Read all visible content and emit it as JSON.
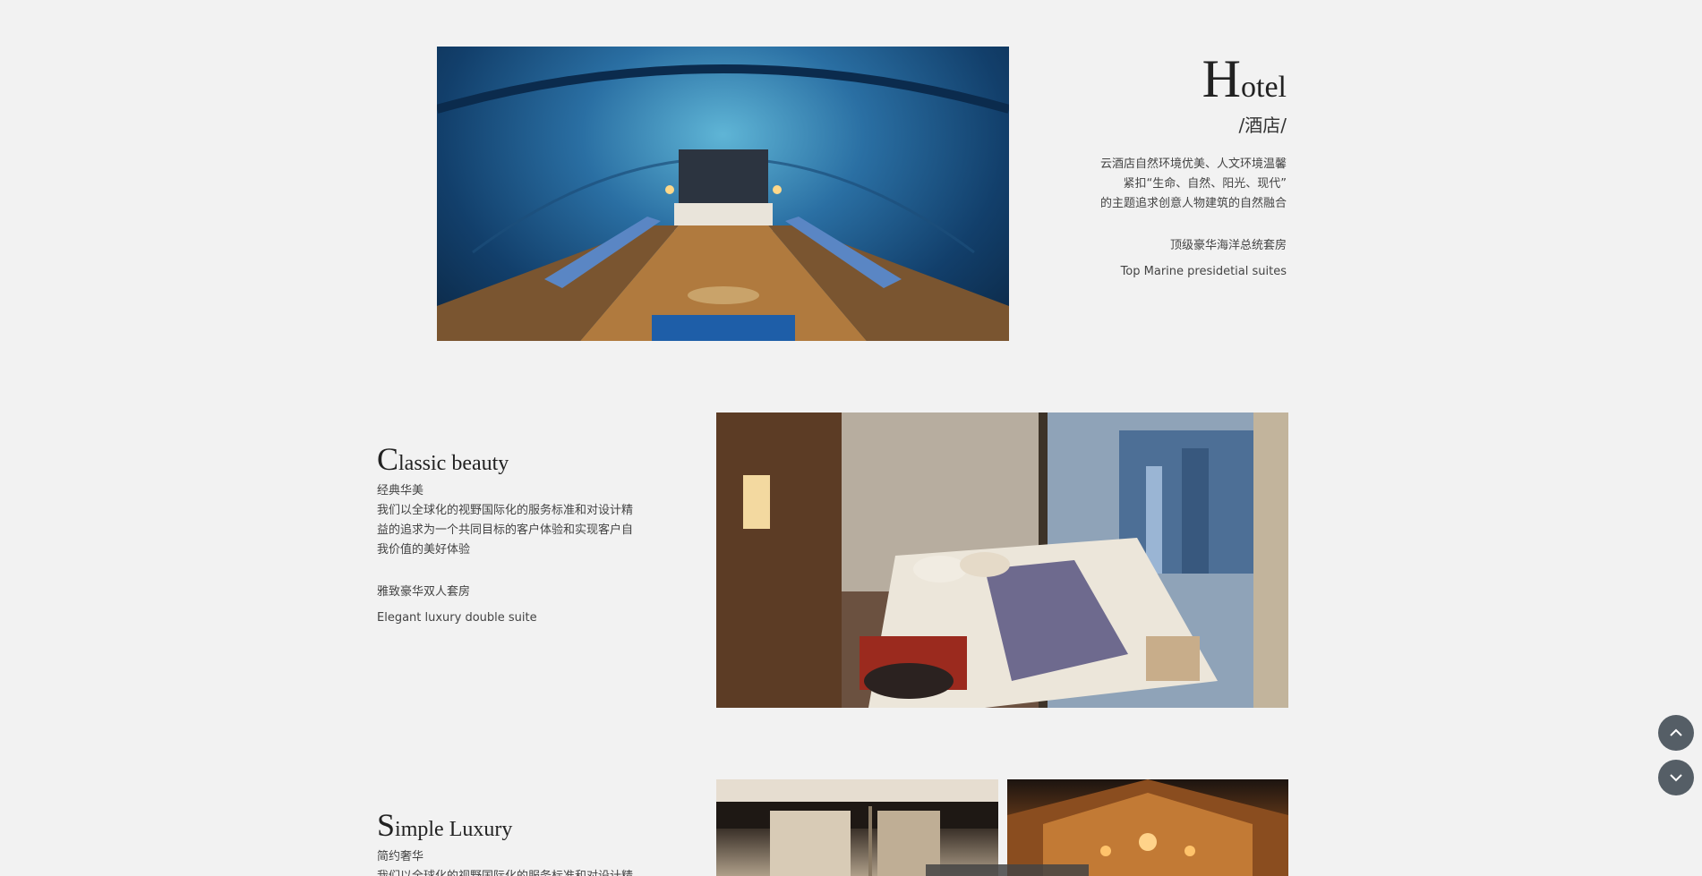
{
  "hotel": {
    "title_cap": "H",
    "title_rest": "otel",
    "subtitle": "/酒店/",
    "desc_lines": [
      "云酒店自然环境优美、人文环境温馨",
      "紧扣“生命、自然、阳光、现代”",
      "的主题追求创意人物建筑的自然融合"
    ],
    "suite_cn": "顶级豪华海洋总统套房",
    "suite_en": "Top Marine presidetial suites"
  },
  "classic": {
    "title_cap": "C",
    "title_rest": "lassic beauty",
    "subtitle_cn": "经典华美",
    "desc_lines": [
      "我们以全球化的视野国际化的服务标准和对设计精",
      "益的追求为一个共同目标的客户体验和实现客户自",
      "我价值的美好体验"
    ],
    "suite_cn": "雅致豪华双人套房",
    "suite_en": "Elegant luxury double suite"
  },
  "simple": {
    "title_cap": "S",
    "title_rest": "imple Luxury",
    "subtitle_cn": "简约奢华",
    "desc_line1": "我们以全球化的视野国际化的服务标准和对设计精"
  },
  "icons": {
    "scroll_up": "chevron-up-icon",
    "scroll_down": "chevron-down-icon"
  },
  "colors": {
    "background": "#f2f2f2",
    "button": "#555e66",
    "text": "#333333"
  }
}
